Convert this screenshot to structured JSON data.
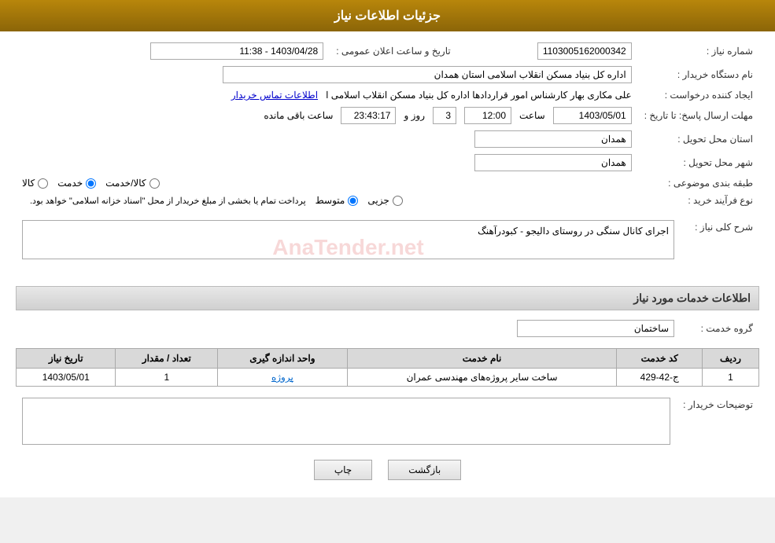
{
  "header": {
    "title": "جزئیات اطلاعات نیاز"
  },
  "fields": {
    "need_number_label": "شماره نیاز :",
    "need_number_value": "1103005162000342",
    "buyer_org_label": "نام دستگاه خریدار :",
    "buyer_org_value": "اداره کل بنیاد مسکن انقلاب اسلامی استان همدان",
    "creator_label": "ایجاد کننده درخواست :",
    "creator_value": "علی مکاری بهار کارشناس امور قراردادها اداره کل بنیاد مسکن انقلاب اسلامی ا",
    "creator_link": "اطلاعات تماس خریدار",
    "deadline_label": "مهلت ارسال پاسخ: تا تاریخ :",
    "deadline_date": "1403/05/01",
    "deadline_time": "12:00",
    "deadline_days": "3",
    "deadline_remaining": "23:43:17",
    "deadline_date_label": "",
    "deadline_time_label": "ساعت",
    "deadline_days_label": "روز و",
    "deadline_remaining_label": "ساعت باقی مانده",
    "announce_label": "تاریخ و ساعت اعلان عمومی :",
    "announce_value": "1403/04/28 - 11:38",
    "province_label": "استان محل تحویل :",
    "province_value": "همدان",
    "city_label": "شهر محل تحویل :",
    "city_value": "همدان",
    "category_label": "طبقه بندی موضوعی :",
    "category_kala": "کالا",
    "category_khadamat": "خدمت",
    "category_kala_khadamat": "کالا/خدمت",
    "process_label": "نوع فرآیند خرید :",
    "process_jozyi": "جزیی",
    "process_motavaset": "متوسط",
    "process_note": "پرداخت تمام یا بخشی از مبلغ خریدار از محل \"اسناد خزانه اسلامی\" خواهد بود.",
    "description_label": "شرح کلی نیاز :",
    "description_value": "اجرای کانال سنگی در روستای دالیجو - کبودرآهنگ",
    "services_section": "اطلاعات خدمات مورد نیاز",
    "service_group_label": "گروه خدمت :",
    "service_group_value": "ساختمان",
    "table_headers": {
      "row_num": "ردیف",
      "service_code": "کد خدمت",
      "service_name": "نام خدمت",
      "unit": "واحد اندازه گیری",
      "quantity": "تعداد / مقدار",
      "date": "تاریخ نیاز"
    },
    "table_rows": [
      {
        "row_num": "1",
        "service_code": "ج-42-429",
        "service_name": "ساخت سایر پروژه‌های مهندسی عمران",
        "unit": "پروژه",
        "quantity": "1",
        "date": "1403/05/01"
      }
    ],
    "buyer_desc_label": "توضیحات خریدار :",
    "btn_print": "چاپ",
    "btn_back": "بازگشت"
  }
}
